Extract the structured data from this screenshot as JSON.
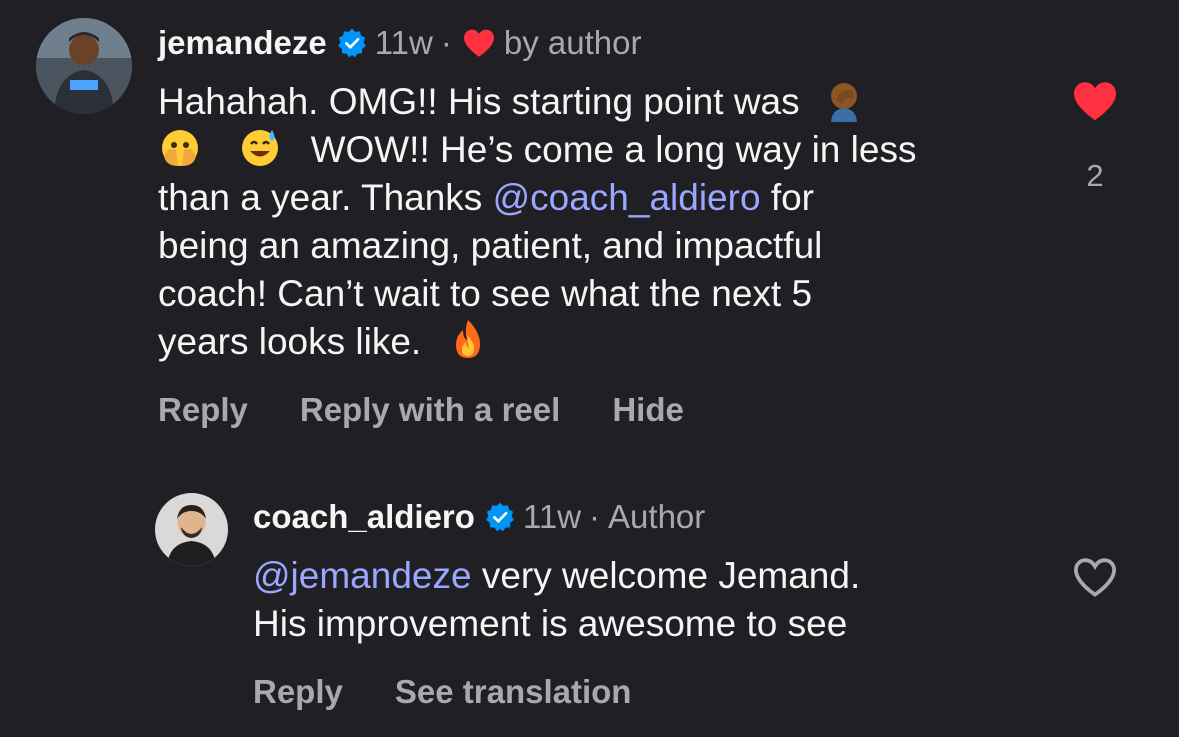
{
  "comment": {
    "username": "jemandeze",
    "age": "11w",
    "separator": "·",
    "liked_by_author": "by author",
    "text_lines": [
      "Hahahah. OMG!! His starting point was",
      "WOW!! He’s come a long way in less",
      "than a year. Thanks",
      "@coach_aldiero",
      "for",
      "being an amazing, patient, and impactful",
      "coach! Can’t wait to see what the next 5",
      "years looks like."
    ],
    "emojis": [
      "face-palm-emoji",
      "face-with-open-eyes-and-hand-over-mouth-emoji",
      "grinning-sweat-emoji",
      "fire-emoji"
    ],
    "actions": {
      "reply": "Reply",
      "reply_with_reel": "Reply with a reel",
      "hide": "Hide"
    },
    "like_count": "2",
    "liked": true,
    "like_color": "#ff3040"
  },
  "reply": {
    "username": "coach_aldiero",
    "age": "11w",
    "separator": "·",
    "role_badge": "Author",
    "mention": "@jemandeze",
    "text_lines": [
      "very welcome Jemand.",
      "His improvement is awesome to see"
    ],
    "actions": {
      "reply": "Reply",
      "see_translation": "See translation"
    },
    "liked": false
  },
  "colors": {
    "background": "#1f1f24",
    "text": "#f5f5f5",
    "muted": "#a8a8b0",
    "mention": "#9aa6ff",
    "verified": "#0095f6"
  }
}
